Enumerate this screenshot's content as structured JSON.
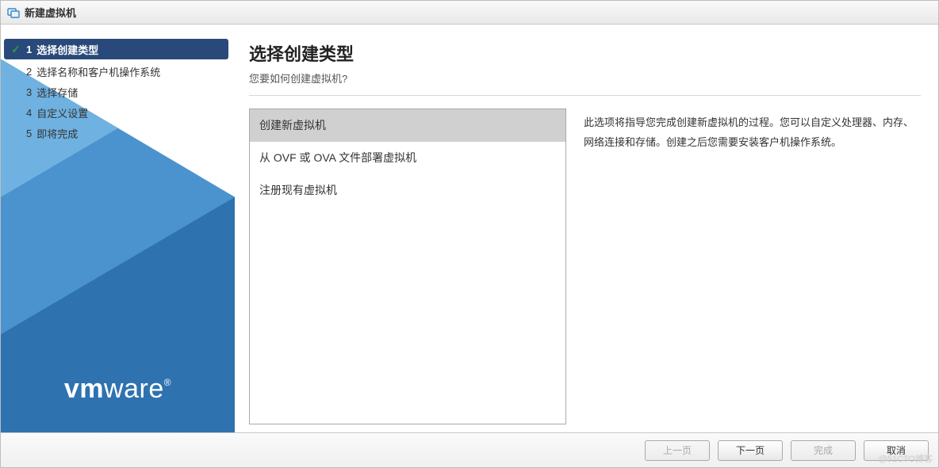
{
  "window": {
    "title": "新建虚拟机"
  },
  "sidebar": {
    "steps": [
      {
        "num": "1",
        "label": "选择创建类型",
        "active": true,
        "checked": true
      },
      {
        "num": "2",
        "label": "选择名称和客户机操作系统",
        "active": false,
        "checked": false
      },
      {
        "num": "3",
        "label": "选择存储",
        "active": false,
        "checked": false
      },
      {
        "num": "4",
        "label": "自定义设置",
        "active": false,
        "checked": false
      },
      {
        "num": "5",
        "label": "即将完成",
        "active": false,
        "checked": false
      }
    ],
    "brand": "vmware"
  },
  "main": {
    "title": "选择创建类型",
    "subtitle": "您要如何创建虚拟机?",
    "options": [
      {
        "label": "创建新虚拟机",
        "selected": true
      },
      {
        "label": "从 OVF 或 OVA 文件部署虚拟机",
        "selected": false
      },
      {
        "label": "注册现有虚拟机",
        "selected": false
      }
    ],
    "description": "此选项将指导您完成创建新虚拟机的过程。您可以自定义处理器、内存、网络连接和存储。创建之后您需要安装客户机操作系统。"
  },
  "footer": {
    "prev": "上一页",
    "next": "下一页",
    "finish": "完成",
    "cancel": "取消"
  },
  "watermark": "@51CTO博客"
}
